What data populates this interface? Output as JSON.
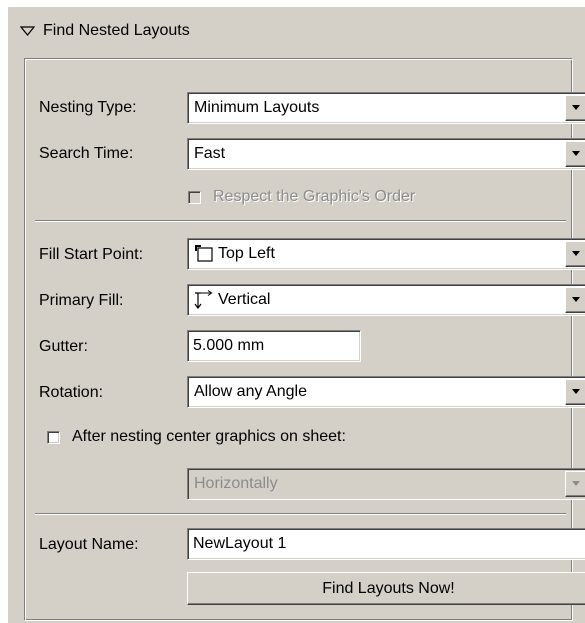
{
  "header": {
    "title": "Find Nested Layouts",
    "collapse_icon": "triangle-down-icon"
  },
  "nesting_type": {
    "label": "Nesting Type:",
    "value": "Minimum Layouts"
  },
  "search_time": {
    "label": "Search Time:",
    "value": "Fast"
  },
  "respect_order": {
    "label": "Respect the Graphic's Order",
    "checked": false,
    "enabled": false
  },
  "fill_start_point": {
    "label": "Fill Start Point:",
    "value": "Top Left",
    "icon": "top-left-corner-icon"
  },
  "primary_fill": {
    "label": "Primary Fill:",
    "value": "Vertical",
    "icon": "vertical-fill-icon"
  },
  "gutter": {
    "label": "Gutter:",
    "value": "5.000 mm"
  },
  "rotation": {
    "label": "Rotation:",
    "value": "Allow any Angle"
  },
  "center_graphics": {
    "label": "After nesting center graphics on sheet:",
    "checked": false
  },
  "center_direction": {
    "value": "Horizontally",
    "enabled": false
  },
  "layout_name": {
    "label": "Layout Name:",
    "value": "NewLayout 1"
  },
  "find_button": {
    "label": "Find Layouts Now!"
  },
  "colors": {
    "panel_bg": "#d4d0c8",
    "field_bg": "#ffffff",
    "disabled_text": "#8c8c8c",
    "shadow": "#808080"
  }
}
